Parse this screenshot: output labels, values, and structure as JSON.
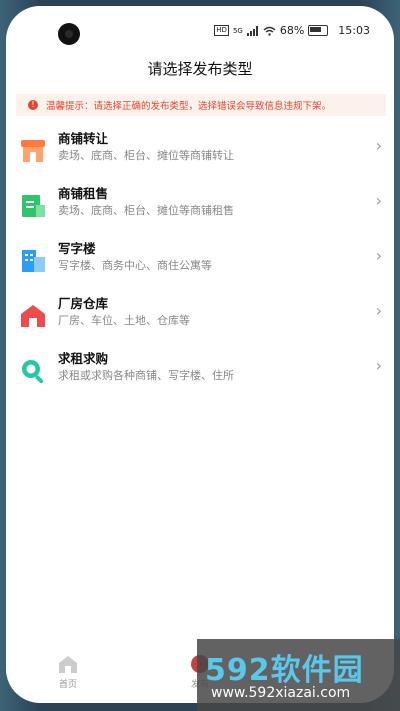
{
  "status_bar": {
    "signal_label": "HD",
    "network_label": "5G",
    "battery_percent": "68%",
    "time": "15:03"
  },
  "page_title": "请选择发布类型",
  "notice": {
    "text": "温馨提示：请选择正确的发布类型，选择错误会导致信息违规下架。"
  },
  "categories": [
    {
      "name": "商铺转让",
      "desc": "卖场、底商、柜台、摊位等商铺转让",
      "icon": "shop-icon",
      "color": "#ff7a3d"
    },
    {
      "name": "商铺租售",
      "desc": "卖场、底商、柜台、摊位等商铺租售",
      "icon": "document-icon",
      "color": "#2fc56b"
    },
    {
      "name": "写字楼",
      "desc": "写字楼、商务中心、商住公寓等",
      "icon": "office-building-icon",
      "color": "#2a9df4"
    },
    {
      "name": "厂房仓库",
      "desc": "厂房、车位、土地、仓库等",
      "icon": "warehouse-icon",
      "color": "#ee4b4b"
    },
    {
      "name": "求租求购",
      "desc": "求租或求购各种商铺、写字楼、住所",
      "icon": "search-icon",
      "color": "#24c7a8"
    }
  ],
  "tabbar": {
    "home_label": "首页",
    "publish_label": "发布"
  },
  "watermark": {
    "brand": "592软件园",
    "url": "www.592xiazai.com"
  }
}
